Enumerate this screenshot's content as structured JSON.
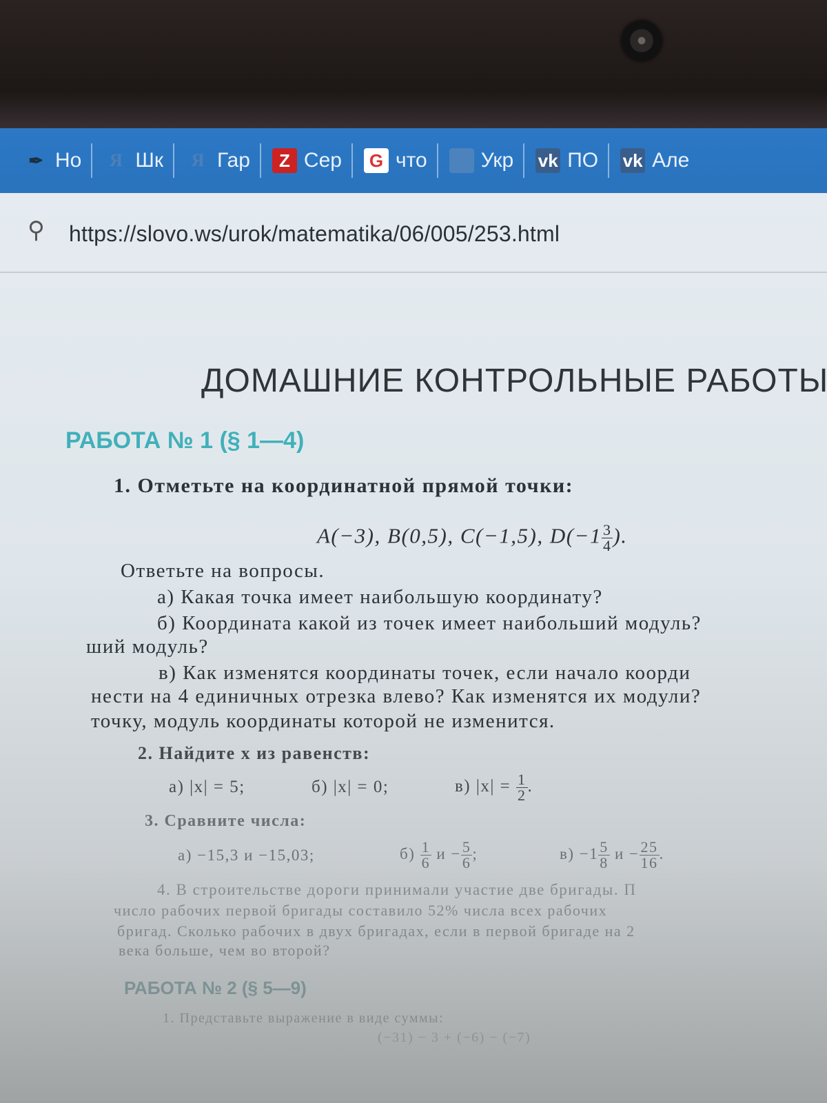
{
  "bookmarks": [
    {
      "label": "Но",
      "icon": "pen-icon"
    },
    {
      "label": "Шк",
      "icon": "reshak-icon"
    },
    {
      "label": "Гар",
      "icon": "reshak-icon"
    },
    {
      "label": "Сер",
      "icon": "z-icon"
    },
    {
      "label": "что",
      "icon": "google-icon"
    },
    {
      "label": "Укр",
      "icon": "ukr-icon"
    },
    {
      "label": "ПО",
      "icon": "vk-icon"
    },
    {
      "label": "Але",
      "icon": "vk-icon"
    }
  ],
  "address": {
    "url": "https://slovo.ws/urok/matematika/06/005/253.html"
  },
  "content": {
    "heading": "ДОМАШНИЕ КОНТРОЛЬНЫЕ РАБОТЫ",
    "work1_title": "РАБОТА № 1 (§ 1—4)",
    "task1": {
      "num": "1.",
      "text": "Отметьте на координатной прямой точки:",
      "points": "A(−3), B(0,5), C(−1,5), D(−1",
      "d_num": "3",
      "d_den": "4",
      "d_tail": ").",
      "questions_intro": "Ответьте на вопросы.",
      "qa": "а) Какая точка имеет наибольшую координату?",
      "qb": "б) Координата какой из точек имеет наибольший модуль?",
      "qb2": "ший модуль?",
      "qv1": "в) Как изменятся координаты точек, если начало коорди",
      "qv2": "нести на 4 единичных отрезка влево? Как изменятся их модули?",
      "qv3": "точку, модуль координаты которой не изменится."
    },
    "task2": {
      "title": "2. Найдите x из равенств:",
      "a": "а) |x| = 5;",
      "b": "б) |x| = 0;",
      "v": "в) |x| =",
      "v_num": "1",
      "v_den": "2",
      "v_tail": "."
    },
    "task3": {
      "title": "3. Сравните числа:",
      "a": "а) −15,3 и −15,03;",
      "b_pre": "б)",
      "b_n1": "1",
      "b_d1": "6",
      "b_mid": "и −",
      "b_n2": "5",
      "b_d2": "6",
      "b_tail": ";",
      "v_pre": "в) −1",
      "v_n1": "5",
      "v_d1": "8",
      "v_mid": "и −",
      "v_n2": "25",
      "v_d2": "16",
      "v_tail": "."
    },
    "task4": {
      "l1": "4. В строительстве дороги принимали участие две бригады. П",
      "l2": "число рабочих первой бригады составило 52% числа всех рабочих",
      "l3": "бригад. Сколько рабочих в двух бригадах, если в первой бригаде на 2",
      "l4": "века больше, чем во второй?"
    },
    "work2_title": "РАБОТА № 2 (§ 5—9)",
    "work2_task1": "1. Представьте выражение в виде суммы:",
    "work2_expr": "(−31) − 3 + (−6) − (−7)"
  }
}
